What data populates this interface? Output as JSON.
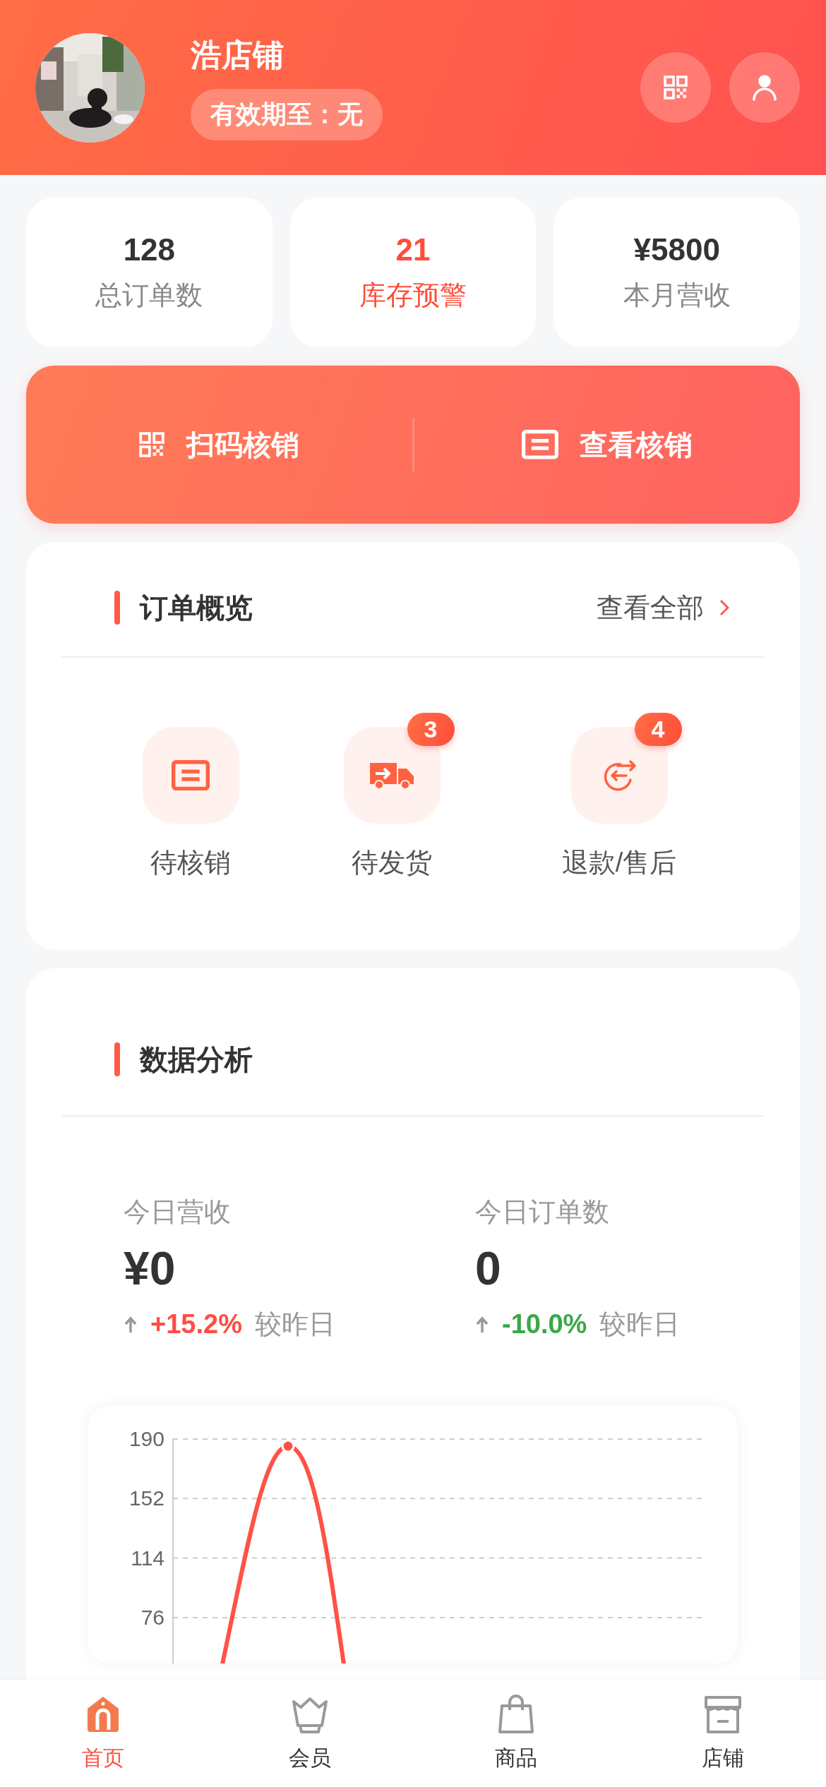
{
  "header": {
    "store_name": "浩店铺",
    "validity": "有效期至：无"
  },
  "stats": [
    {
      "value": "128",
      "label": "总订单数",
      "alert": false
    },
    {
      "value": "21",
      "label": "库存预警",
      "alert": true
    },
    {
      "value": "¥5800",
      "label": "本月营收",
      "alert": false
    }
  ],
  "actions": [
    {
      "label": "扫码核销"
    },
    {
      "label": "查看核销"
    }
  ],
  "order_overview": {
    "title": "订单概览",
    "link": "查看全部",
    "items": [
      {
        "label": "待核销"
      },
      {
        "label": "待发货",
        "badge": "3"
      },
      {
        "label": "退款/售后",
        "badge": "4"
      }
    ]
  },
  "data_analysis": {
    "title": "数据分析",
    "metrics": [
      {
        "label": "今日营收",
        "value": "¥0",
        "change": "+15.2%",
        "kind": "rise",
        "compare": "较昨日"
      },
      {
        "label": "今日订单数",
        "value": "0",
        "change": "-10.0%",
        "kind": "fall",
        "compare": "较昨日"
      }
    ],
    "chart": {
      "y_axis_labels": [
        "190",
        "152",
        "114",
        "76"
      ]
    }
  },
  "tab_bar": [
    {
      "label": "首页",
      "selected": true
    },
    {
      "label": "会员",
      "selected": false
    },
    {
      "label": "商品",
      "selected": false
    },
    {
      "label": "店铺",
      "selected": false
    }
  ]
}
